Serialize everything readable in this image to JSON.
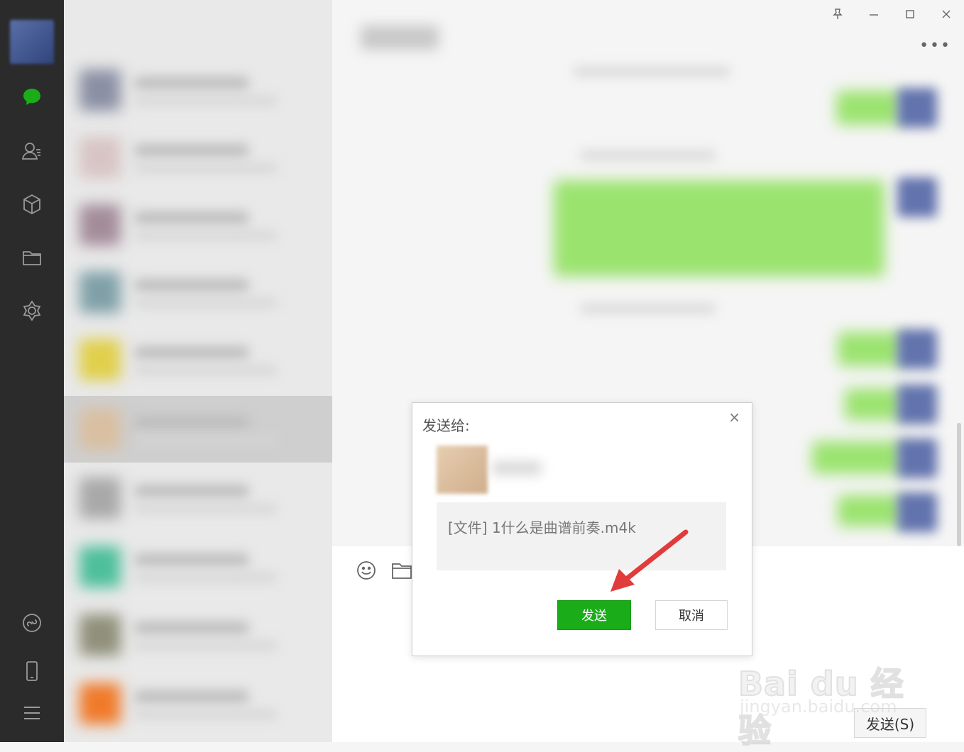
{
  "window": {
    "pin_icon": "pin-icon",
    "minimize_icon": "minimize-icon",
    "maximize_icon": "maximize-icon",
    "close_icon": "close-icon",
    "more_label": "•••"
  },
  "sidebar": {
    "items": [
      {
        "icon": "chat-icon"
      },
      {
        "icon": "contacts-icon"
      },
      {
        "icon": "box-icon"
      },
      {
        "icon": "folder-icon"
      },
      {
        "icon": "moments-icon"
      },
      {
        "icon": "miniprogram-icon"
      },
      {
        "icon": "phone-icon"
      },
      {
        "icon": "menu-icon"
      }
    ]
  },
  "toolbar": {
    "emoji_icon": "emoji-icon",
    "file_icon": "folder-icon"
  },
  "dialog": {
    "title": "发送给:",
    "close_label": "×",
    "file_text": "[文件] 1什么是曲谱前奏.m4k",
    "send_label": "发送",
    "cancel_label": "取消"
  },
  "input": {
    "send_label": "发送(S)"
  },
  "watermark": {
    "main": "Bai du 经验",
    "sub": "jingyan.baidu.com"
  },
  "colors": {
    "accent_green": "#1aad19",
    "sidebar_bg": "#2b2b2b",
    "chat_green": "#9be36f"
  }
}
